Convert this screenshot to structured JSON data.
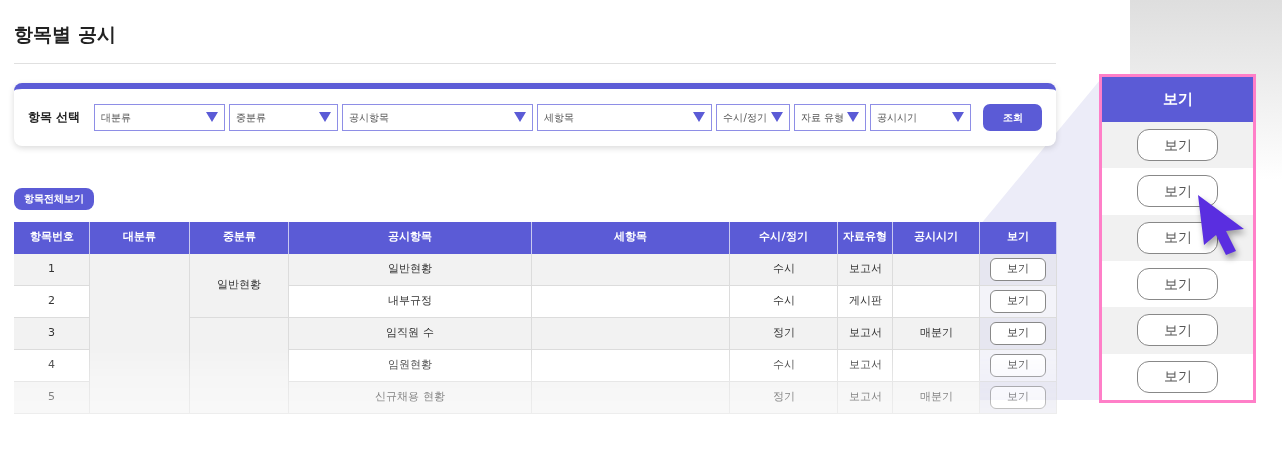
{
  "page_title": "항목별 공시",
  "filter": {
    "label": "항목 선택",
    "dropdowns": [
      {
        "placeholder": "대분류"
      },
      {
        "placeholder": "중분류"
      },
      {
        "placeholder": "공시항목"
      },
      {
        "placeholder": "세항목"
      },
      {
        "placeholder": "수시/정기"
      },
      {
        "placeholder": "자료 유형"
      },
      {
        "placeholder": "공시시기"
      }
    ],
    "search_button": "조회"
  },
  "view_all_button": "항목전체보기",
  "table": {
    "columns": [
      "항목번호",
      "대분류",
      "중분류",
      "공시항목",
      "세항목",
      "수시/정기",
      "자료유형",
      "공시시기",
      "보기"
    ],
    "groups": [
      {
        "middle_category": "일반현황",
        "rows": [
          {
            "number": "1",
            "item": "일반현황",
            "frequency": "수시",
            "data_type": "보고서",
            "button": "보기"
          },
          {
            "number": "2",
            "item": "내부규정",
            "frequency": "수시",
            "data_type": "게시판",
            "button": "보기"
          }
        ]
      },
      {
        "rows": [
          {
            "number": "3",
            "item": "임직원 수",
            "frequency": "정기",
            "data_type": "보고서",
            "timing": "매분기",
            "button": "보기"
          },
          {
            "number": "4",
            "item": "임원현황",
            "frequency": "수시",
            "data_type": "보고서",
            "button": "보기"
          },
          {
            "number": "5",
            "item": "신규채용 현황",
            "frequency": "정기",
            "data_type": "보고서",
            "timing": "매분기",
            "button": "보기"
          }
        ]
      }
    ]
  },
  "callout": {
    "header": "보기",
    "buttons": [
      "보기",
      "보기",
      "보기",
      "보기",
      "보기",
      "보기"
    ]
  }
}
